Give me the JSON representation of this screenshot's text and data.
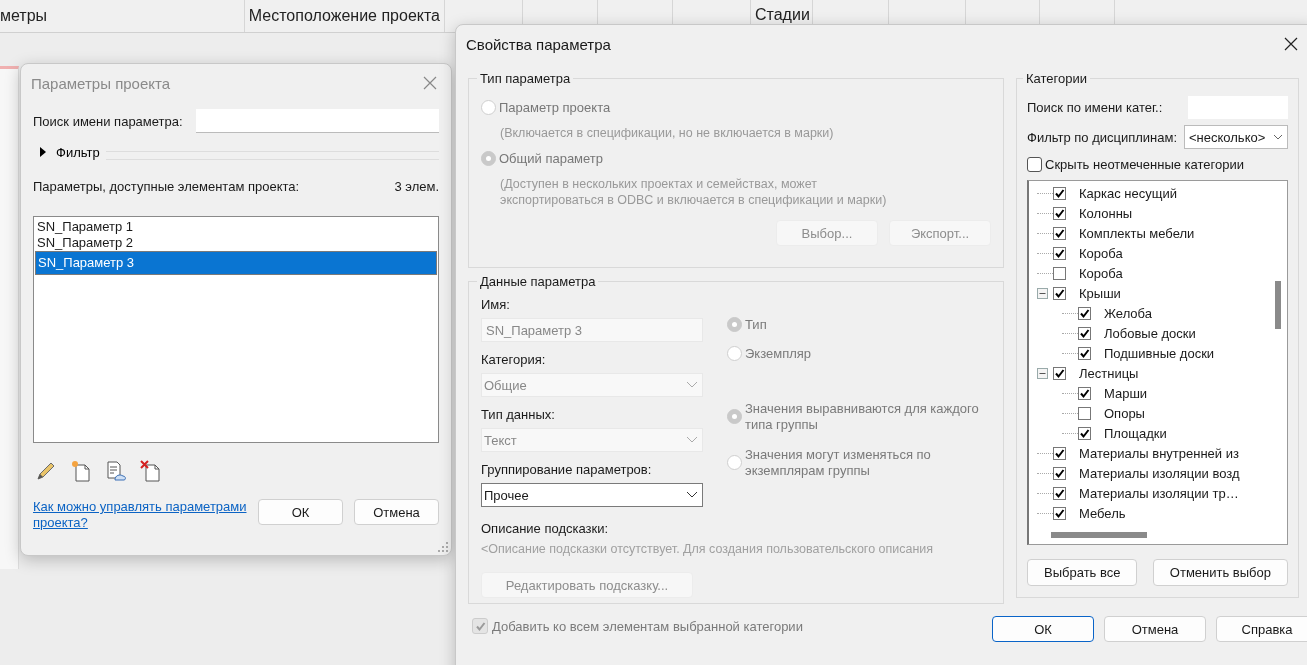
{
  "header": {
    "columns": [
      {
        "label": "метры"
      },
      {
        "label": "Местоположение проекта"
      },
      {
        "label": "Стадии"
      }
    ]
  },
  "project_parameters": {
    "title": "Параметры проекта",
    "search_label": "Поиск имени параметра:",
    "filter": {
      "label": "Фильтр",
      "expanded": false
    },
    "list_label": "Параметры, доступные элементам проекта:",
    "count": "3 элем.",
    "parameters": [
      {
        "name": "SN_Параметр 1",
        "selected": false
      },
      {
        "name": "SN_Параметр 2",
        "selected": false
      },
      {
        "name": "SN_Параметр 3",
        "selected": true
      }
    ],
    "help_link": "Как можно управлять параметрами проекта?",
    "buttons": [
      "ОК",
      "Отмена"
    ]
  },
  "parameter_properties": {
    "title": "Свойства параметра",
    "parameter_type": {
      "title": "Тип параметра",
      "options": [
        {
          "label": "Параметр проекта",
          "description": "(Включается в спецификации, но не включается в марки)",
          "selected": false,
          "disabled": true
        },
        {
          "label": "Общий параметр",
          "description": "(Доступен в нескольких проектах и семействах, может экспортироваться в ODBC и включается в спецификации и марки)",
          "selected": true,
          "disabled": true
        }
      ],
      "buttons": [
        {
          "label": "Выбор...",
          "disabled": true
        },
        {
          "label": "Экспорт...",
          "disabled": true
        }
      ]
    },
    "parameter_data": {
      "title": "Данные параметра",
      "fields": [
        {
          "label": "Имя:",
          "value": "SN_Параметр 3",
          "kind": "text",
          "disabled": true
        },
        {
          "label": "Категория:",
          "value": "Общие",
          "kind": "select",
          "disabled": true
        },
        {
          "label": "Тип данных:",
          "value": "Текст",
          "kind": "select",
          "disabled": true
        },
        {
          "label": "Группирование параметров:",
          "value": "Прочее",
          "kind": "select",
          "disabled": false
        }
      ],
      "binding_options": [
        {
          "label": "Тип",
          "selected": true,
          "disabled": true
        },
        {
          "label": "Экземпляр",
          "selected": false,
          "disabled": true
        }
      ],
      "group_options": [
        {
          "label": "Значения выравниваются для каждого типа группы",
          "selected": true,
          "disabled": true
        },
        {
          "label": "Значения могут изменяться по экземплярам группы",
          "selected": false,
          "disabled": true
        }
      ],
      "hint_label": "Описание подсказки:",
      "hint_text": "<Описание подсказки отсутствует. Для создания пользовательского описания",
      "edit_hint_button": {
        "label": "Редактировать подсказку...",
        "disabled": true
      }
    },
    "add_to_all": {
      "label": "Добавить ко всем элементам выбранной категории",
      "checked": true,
      "disabled": true
    },
    "categories": {
      "title": "Категории",
      "search_label": "Поиск по имени катег.:",
      "discipline_label": "Фильтр по дисциплинам:",
      "discipline_value": "<несколько>",
      "hide_unchecked": {
        "label": "Скрыть неотмеченные категории",
        "checked": false
      },
      "tree": [
        {
          "label": "Каркас несущий",
          "checked": true
        },
        {
          "label": "Колонны",
          "checked": true
        },
        {
          "label": "Комплекты мебели",
          "checked": true
        },
        {
          "label": "Короба",
          "checked": true
        },
        {
          "label": "Короба",
          "checked": false
        },
        {
          "label": "Крыши",
          "checked": true,
          "expanded": true,
          "children": [
            {
              "label": "Желоба",
              "checked": true
            },
            {
              "label": "Лобовые доски",
              "checked": true
            },
            {
              "label": "Подшивные доски",
              "checked": true
            }
          ]
        },
        {
          "label": "Лестницы",
          "checked": true,
          "expanded": true,
          "children": [
            {
              "label": "Марши",
              "checked": true
            },
            {
              "label": "Опоры",
              "checked": false
            },
            {
              "label": "Площадки",
              "checked": true
            }
          ]
        },
        {
          "label": "Материалы внутренней из",
          "checked": true
        },
        {
          "label": "Материалы изоляции возд",
          "checked": true
        },
        {
          "label": "Материалы изоляции тр…",
          "checked": true
        },
        {
          "label": "Мебель",
          "checked": true
        }
      ],
      "buttons": [
        "Выбрать все",
        "Отменить выбор"
      ]
    },
    "buttons": [
      {
        "label": "ОК",
        "default": true
      },
      {
        "label": "Отмена",
        "default": false
      },
      {
        "label": "Справка",
        "default": false
      }
    ]
  }
}
